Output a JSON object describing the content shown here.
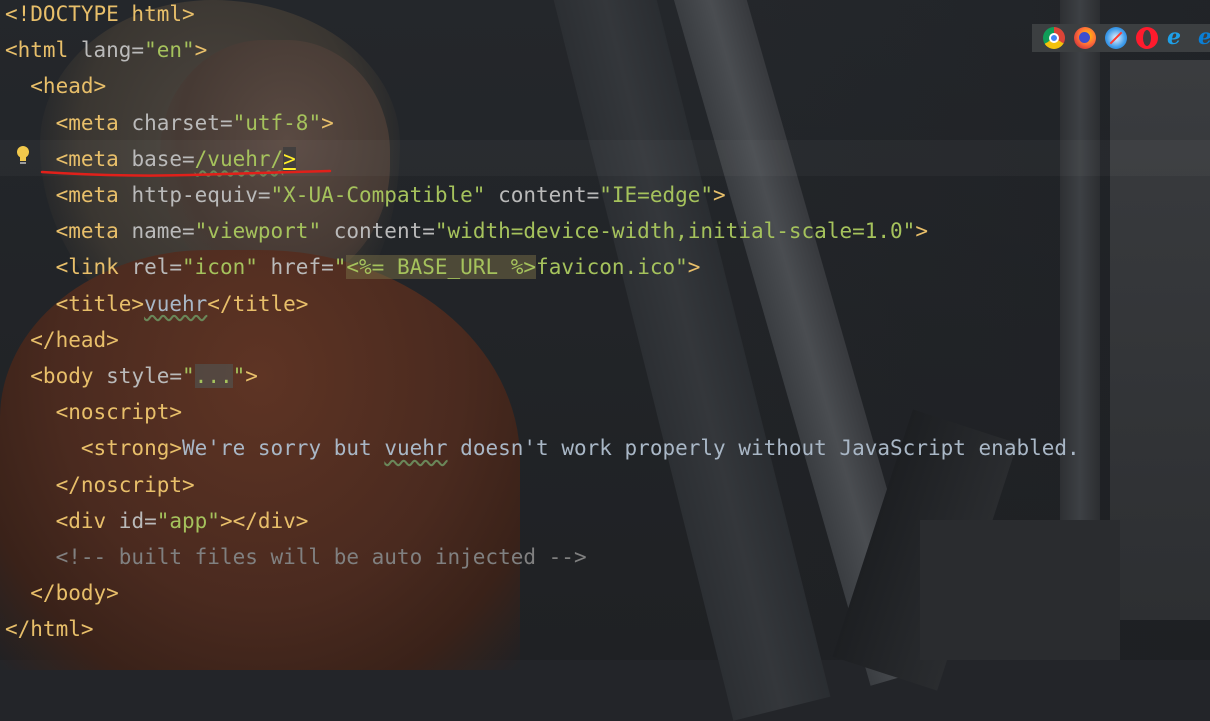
{
  "editor": {
    "lines": [
      {
        "tokens": [
          {
            "t": "tag",
            "s": "<!DOCTYPE html>"
          }
        ]
      },
      {
        "tokens": [
          {
            "t": "tag",
            "s": "<html "
          },
          {
            "t": "attr",
            "s": "lang="
          },
          {
            "t": "val",
            "s": "\"en\""
          },
          {
            "t": "tag",
            "s": ">"
          }
        ]
      },
      {
        "tokens": [
          {
            "t": "tag",
            "s": "  <head>"
          }
        ]
      },
      {
        "tokens": [
          {
            "t": "tag",
            "s": "    <meta "
          },
          {
            "t": "attr",
            "s": "charset="
          },
          {
            "t": "val",
            "s": "\"utf-8\""
          },
          {
            "t": "tag",
            "s": ">"
          }
        ]
      },
      {
        "tokens": [
          {
            "t": "taghl",
            "s": "    <meta"
          },
          {
            "t": "attr",
            "s": " base="
          },
          {
            "t": "valsq",
            "s": "/vuehr/"
          },
          {
            "t": "taghl2",
            "s": ">"
          }
        ]
      },
      {
        "tokens": [
          {
            "t": "tag",
            "s": "    <meta "
          },
          {
            "t": "attr",
            "s": "http-equiv="
          },
          {
            "t": "val",
            "s": "\"X-UA-Compatible\""
          },
          {
            "t": "attr",
            "s": " content="
          },
          {
            "t": "val",
            "s": "\"IE=edge\""
          },
          {
            "t": "tag",
            "s": ">"
          }
        ]
      },
      {
        "tokens": [
          {
            "t": "tag",
            "s": "    <meta "
          },
          {
            "t": "attr",
            "s": "name="
          },
          {
            "t": "val",
            "s": "\"viewport\""
          },
          {
            "t": "attr",
            "s": " content="
          },
          {
            "t": "val",
            "s": "\"width=device-width,initial-scale=1.0\""
          },
          {
            "t": "tag",
            "s": ">"
          }
        ]
      },
      {
        "tokens": [
          {
            "t": "tag",
            "s": "    <link "
          },
          {
            "t": "attr",
            "s": "rel="
          },
          {
            "t": "val",
            "s": "\"icon\""
          },
          {
            "t": "attr",
            "s": " href="
          },
          {
            "t": "val",
            "s": "\""
          },
          {
            "t": "tmpl",
            "s": "<%= BASE_URL %>"
          },
          {
            "t": "val",
            "s": "favicon.ico\""
          },
          {
            "t": "tag",
            "s": ">"
          }
        ]
      },
      {
        "tokens": [
          {
            "t": "tag",
            "s": "    <title>"
          },
          {
            "t": "textsq",
            "s": "vuehr"
          },
          {
            "t": "tag",
            "s": "</title>"
          }
        ]
      },
      {
        "tokens": [
          {
            "t": "tag",
            "s": "  </head>"
          }
        ]
      },
      {
        "tokens": [
          {
            "t": "tag",
            "s": "  <body "
          },
          {
            "t": "attr",
            "s": "style="
          },
          {
            "t": "val",
            "s": "\""
          },
          {
            "t": "fold",
            "s": "..."
          },
          {
            "t": "val",
            "s": "\""
          },
          {
            "t": "tag",
            "s": ">"
          }
        ]
      },
      {
        "tokens": [
          {
            "t": "tag",
            "s": "    <noscript>"
          }
        ]
      },
      {
        "tokens": [
          {
            "t": "tag",
            "s": "      <strong>"
          },
          {
            "t": "text",
            "s": "We're sorry but "
          },
          {
            "t": "textsq",
            "s": "vuehr"
          },
          {
            "t": "text",
            "s": " doesn't work properly without JavaScript enabled."
          }
        ]
      },
      {
        "tokens": [
          {
            "t": "tag",
            "s": "    </noscript>"
          }
        ]
      },
      {
        "tokens": [
          {
            "t": "tag",
            "s": "    <div "
          },
          {
            "t": "attr",
            "s": "id="
          },
          {
            "t": "val",
            "s": "\"app\""
          },
          {
            "t": "tag",
            "s": "></div>"
          }
        ]
      },
      {
        "tokens": [
          {
            "t": "comment",
            "s": "    <!-- built files will be auto injected -->"
          }
        ]
      },
      {
        "tokens": [
          {
            "t": "tag",
            "s": "  </body>"
          }
        ]
      },
      {
        "tokens": [
          {
            "t": "tag",
            "s": "</html>"
          }
        ]
      }
    ]
  },
  "browser_icons": [
    "chrome-icon",
    "firefox-icon",
    "safari-icon",
    "opera-icon",
    "ie-icon",
    "edge-icon"
  ],
  "colors": {
    "tag": "#e8bf6a",
    "attr": "#bababa",
    "value": "#a5c25c",
    "text": "#a9b7c6",
    "comment": "#808080",
    "annotation": "#e0201a"
  }
}
